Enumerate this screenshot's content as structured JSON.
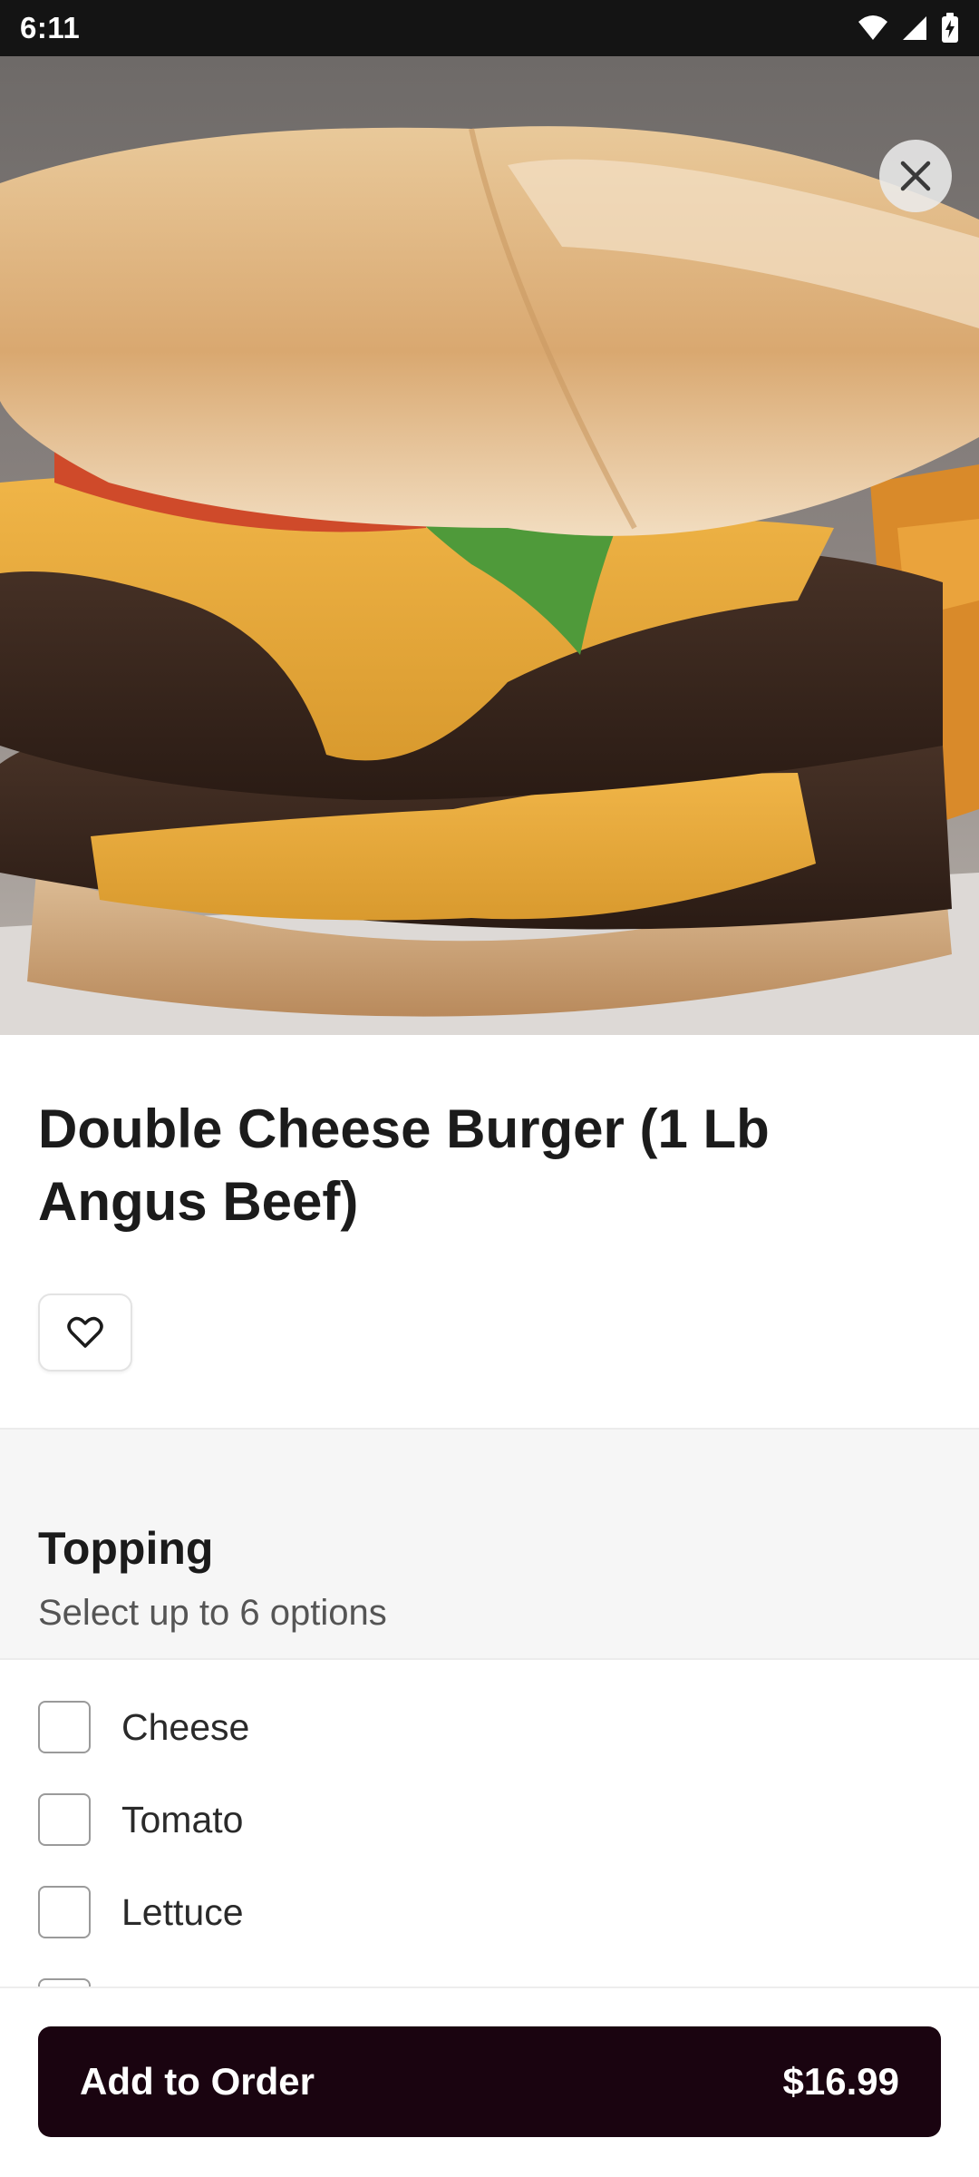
{
  "status_bar": {
    "time": "6:11",
    "icons": [
      "wifi-icon",
      "cellular-signal-icon",
      "battery-charging-icon"
    ]
  },
  "hero": {
    "image": "burger-photo",
    "close_icon": "close-icon"
  },
  "item": {
    "title": "Double Cheese Burger (1 Lb Angus Beef)",
    "favorite_icon": "heart-icon"
  },
  "topping": {
    "title": "Topping",
    "subtitle": "Select up to 6 options",
    "options": [
      {
        "label": "Cheese",
        "checked": false
      },
      {
        "label": "Tomato",
        "checked": false
      },
      {
        "label": "Lettuce",
        "checked": false
      }
    ]
  },
  "cta": {
    "label": "Add to Order",
    "price": "$16.99",
    "color": "#1a0410"
  }
}
